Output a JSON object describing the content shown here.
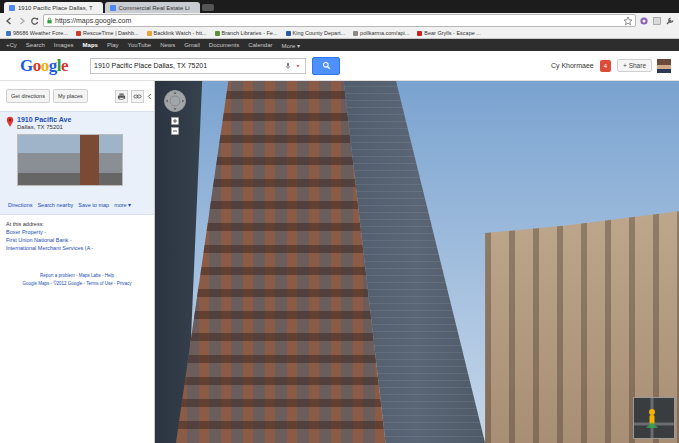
{
  "browser": {
    "tabs": [
      {
        "label": "1910 Pacific Place Dallas, T",
        "selected": true
      },
      {
        "label": "Commercial Real Estate Li",
        "selected": false
      }
    ],
    "url": "https://maps.google.com",
    "bookmarks": [
      {
        "label": "98686 Weather Fore...",
        "color": "#3a78c2"
      },
      {
        "label": "RescueTime | Dashb...",
        "color": "#d23b2a"
      },
      {
        "label": "Backlink Watch - htt...",
        "color": "#e8a33a"
      },
      {
        "label": "Branch Libraries - Fe...",
        "color": "#5a8f3c"
      },
      {
        "label": "King County Depart...",
        "color": "#2c5aa0"
      },
      {
        "label": "pollkarma.com/api...",
        "color": "#8a8a8a"
      },
      {
        "label": "Bear Grylls - Escape ...",
        "color": "#cc2222"
      }
    ]
  },
  "google_bar": {
    "items": [
      {
        "label": "+Cy",
        "selected": false
      },
      {
        "label": "Search",
        "selected": false
      },
      {
        "label": "Images",
        "selected": false
      },
      {
        "label": "Maps",
        "selected": true
      },
      {
        "label": "Play",
        "selected": false
      },
      {
        "label": "YouTube",
        "selected": false
      },
      {
        "label": "News",
        "selected": false
      },
      {
        "label": "Gmail",
        "selected": false
      },
      {
        "label": "Documents",
        "selected": false
      },
      {
        "label": "Calendar",
        "selected": false
      },
      {
        "label": "More ▾",
        "selected": false
      }
    ]
  },
  "header": {
    "logo": "Google",
    "search": "1910 Pacific Place Dallas, TX 75201",
    "user": "Cy Khormaee",
    "notifications": "4",
    "share": "+ Share"
  },
  "sidebar": {
    "buttons": [
      "Get directions",
      "My places"
    ],
    "place": {
      "title": "1910 Pacific Ave",
      "address": "Dallas, TX 75201"
    },
    "links": [
      "Directions",
      "Search nearby",
      "Save to map",
      "more ▾"
    ],
    "at_address_label": "At this address:",
    "at_address": [
      "Boxer Property -",
      "First Union National Bank -",
      "International Merchant Services (A -"
    ],
    "footer": [
      "Report a problem - Maps Labs - Help",
      "Google Maps - ©2012 Google - Terms of Use - Privacy"
    ]
  }
}
